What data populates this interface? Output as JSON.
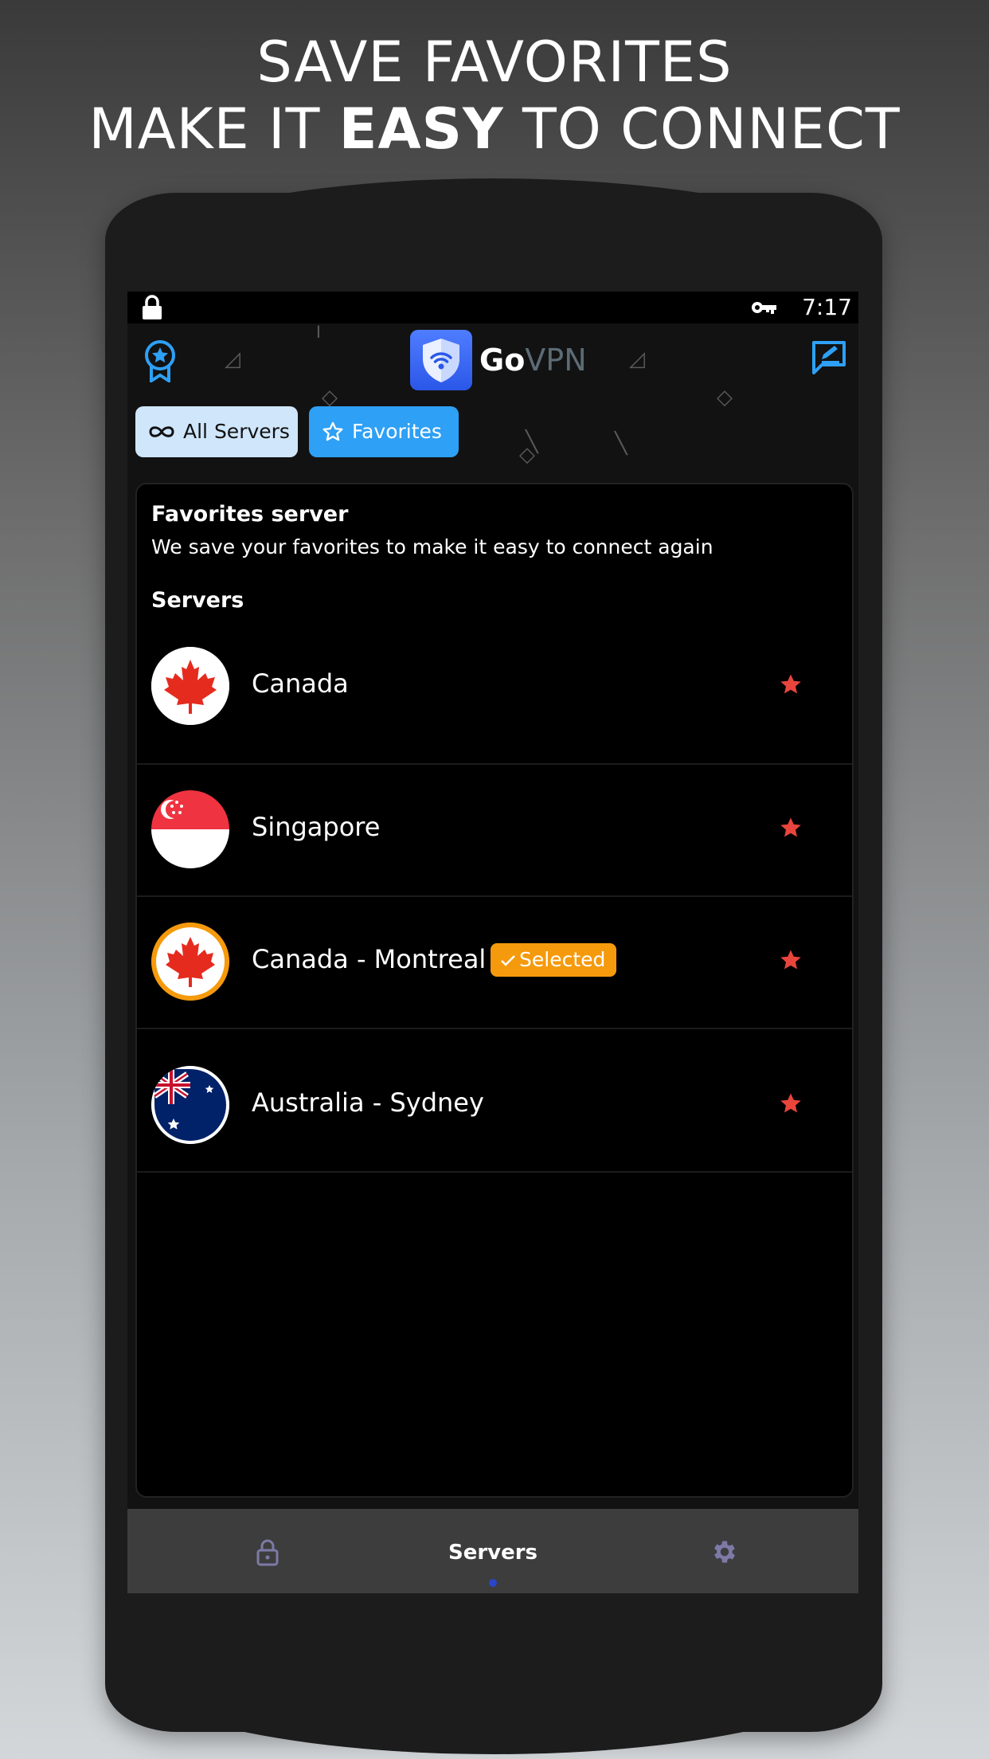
{
  "headline": {
    "line1": "SAVE FAVORITES",
    "line2_prefix": "MAKE IT ",
    "line2_bold": "EASY",
    "line2_suffix": " TO CONNECT"
  },
  "status_bar": {
    "time": "7:17",
    "icons": [
      "lock-icon",
      "vpn-key-icon"
    ]
  },
  "app_bar": {
    "brand_go": "Go",
    "brand_vpn": "VPN",
    "left_icon": "award-icon",
    "right_icon": "feedback-icon"
  },
  "tabs": [
    {
      "label": "All Servers",
      "icon": "infinity-icon",
      "active": false
    },
    {
      "label": "Favorites",
      "icon": "star-outline-icon",
      "active": true
    }
  ],
  "favorites_card": {
    "title": "Favorites server",
    "description": "We save your favorites to make it easy to connect again",
    "section_label": "Servers"
  },
  "servers": [
    {
      "name": "Canada",
      "flag": "canada-flag-icon",
      "favorite": true,
      "selected": false
    },
    {
      "name": "Singapore",
      "flag": "singapore-flag-icon",
      "favorite": true,
      "selected": false
    },
    {
      "name": "Canada - Montreal",
      "flag": "canada-flag-icon",
      "favorite": true,
      "selected": true,
      "badge": "Selected"
    },
    {
      "name": "Australia - Sydney",
      "flag": "australia-flag-icon",
      "favorite": true,
      "selected": false
    }
  ],
  "bottom_nav": {
    "items": [
      "lock-icon",
      "Servers",
      "gear-icon"
    ],
    "active_label": "Servers"
  },
  "colors": {
    "accent_blue": "#2ea0f5",
    "star_red": "#e8453c",
    "selected_orange": "#f59a0c",
    "tab_inactive_bg": "#cfe6fb"
  }
}
